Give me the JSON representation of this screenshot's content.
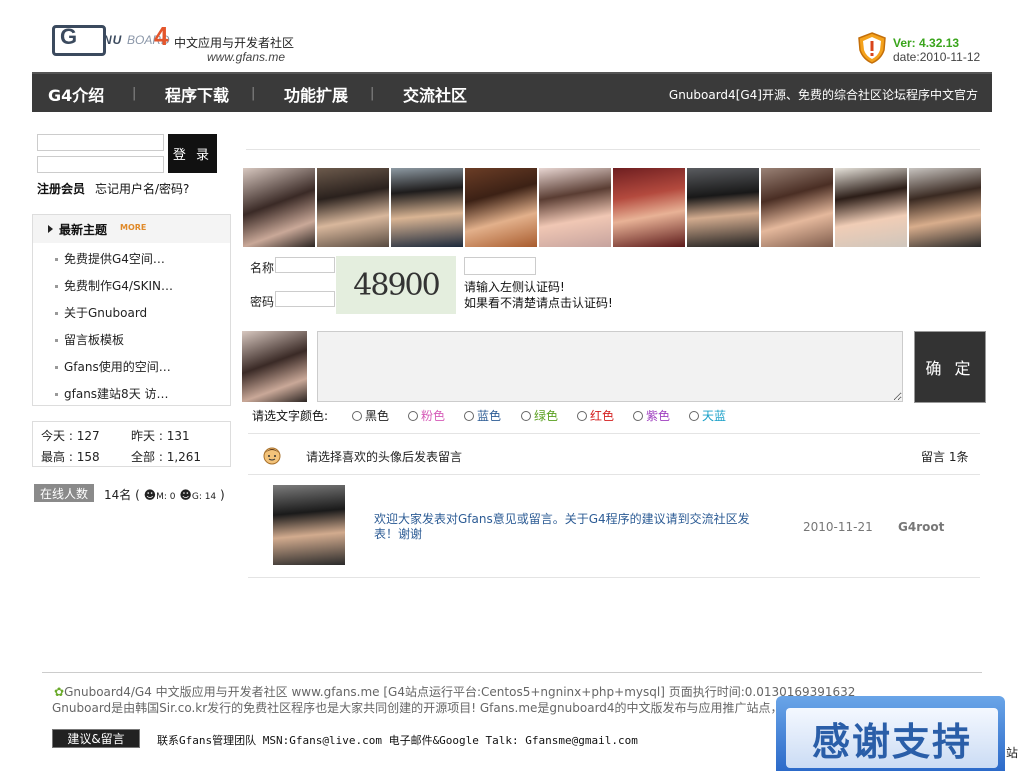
{
  "header": {
    "logo_g": "G",
    "logo_nu": "NU",
    "logo_board": "BOARD",
    "logo_4": "4",
    "logo_cn": "中文应用与开发者社区",
    "logo_url": "www.gfans.me",
    "version": "Ver: 4.32.13",
    "date": "date:2010-11-12"
  },
  "nav": {
    "items": [
      "G4介绍",
      "程序下载",
      "功能扩展",
      "交流社区"
    ],
    "separator": "|",
    "right_text": "Gnuboard4[G4]开源、免费的综合社区论坛程序中文官方"
  },
  "login": {
    "button": "登 录",
    "register": "注册会员",
    "forgot": "忘记用户名/密码?"
  },
  "latest": {
    "title": "最新主题",
    "more": "MORE",
    "items": [
      "免费提供G4空间…",
      "免费制作G4/SKIN…",
      "关于Gnuboard",
      "留言板模板",
      "Gfans使用的空间…",
      "gfans建站8天 访…"
    ]
  },
  "stats": {
    "today_label": "今天 : ",
    "today": "127",
    "yesterday_label": "昨天 : ",
    "yesterday": "131",
    "max_label": "最高 : ",
    "max": "158",
    "total_label": "全部 : ",
    "total": "1,261"
  },
  "online": {
    "label": "在线人数",
    "count": "14名",
    "members": "M: 0",
    "guests": "G: 14"
  },
  "form": {
    "name_label": "名称",
    "password_label": "密码",
    "captcha": "48900",
    "hint1": "请输入左侧认证码!",
    "hint2": "如果看不清楚请点击认证码!",
    "submit": "确 定",
    "color_label": "请选文字颜色:",
    "colors": [
      {
        "label": "黑色",
        "color": "#222222"
      },
      {
        "label": "粉色",
        "color": "#d65cb8"
      },
      {
        "label": "蓝色",
        "color": "#2d5c95"
      },
      {
        "label": "绿色",
        "color": "#5aa020"
      },
      {
        "label": "红色",
        "color": "#d42020"
      },
      {
        "label": "紫色",
        "color": "#a040c0"
      },
      {
        "label": "天蓝",
        "color": "#1aa0c8"
      }
    ]
  },
  "guestbook": {
    "prompt": "请选择喜欢的头像后发表留言",
    "count": "留言 1条",
    "message": "欢迎大家发表对Gfans意见或留言。关于G4程序的建议请到交流社区发表！谢谢",
    "message_date": "2010-11-21",
    "message_user": "G4root"
  },
  "footer": {
    "line1": "Gnuboard4/G4 中文版应用与开发者社区  www.gfans.me [G4站点运行平台:Centos5+ngninx+php+mysql] 页面执行时间:0.0130169391632",
    "line2": "Gnuboard是由韩国Sir.co.kr发行的免费社区程序也是大家共同创建的开源项目!  Gfans.me是gnuboard4的中文版发布与应用推广站点，非",
    "guestbook_button": "建议&留言",
    "contact": "联系Gfans管理团队 MSN:Gfans@live.com 电子邮件&Google Talk: Gfansme@gmail.com",
    "banner": "感谢支持",
    "banner_rest": "站"
  }
}
